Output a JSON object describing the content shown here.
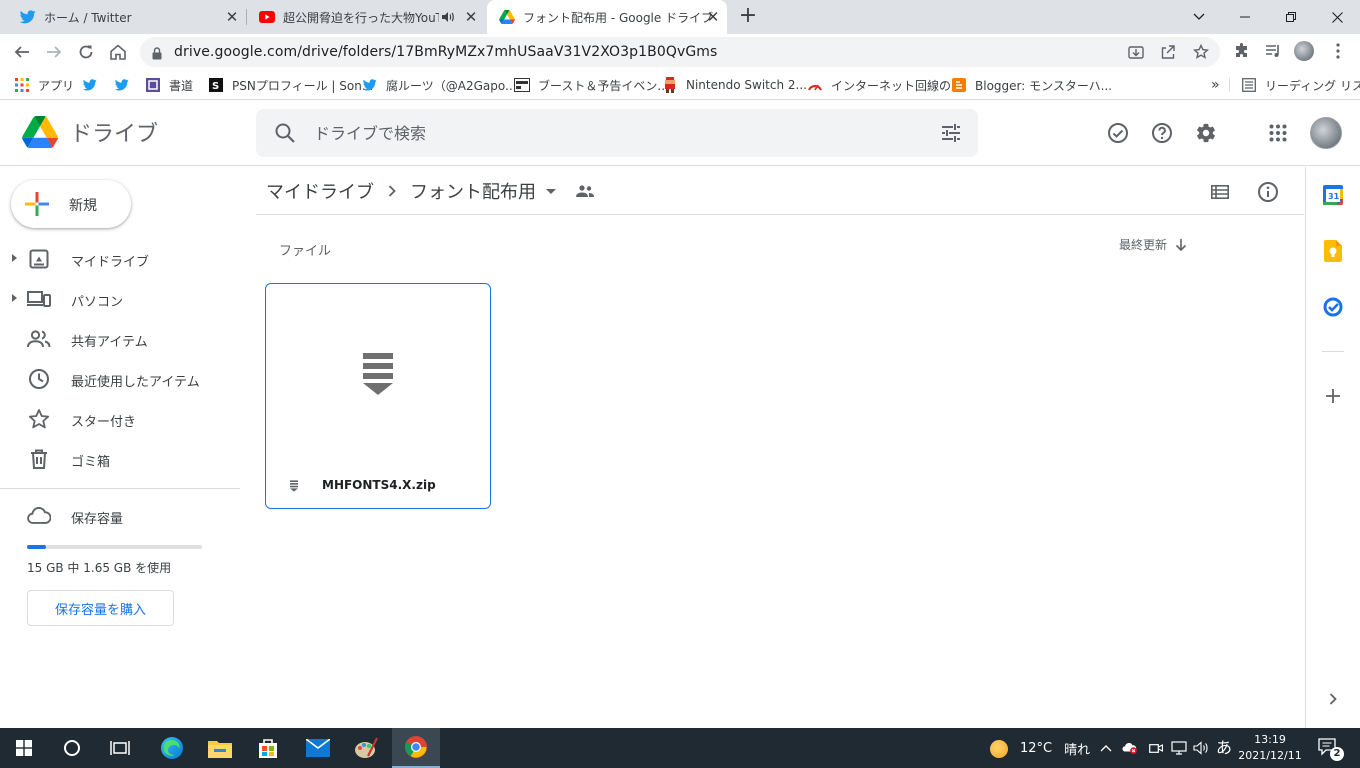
{
  "browser": {
    "tabs": [
      {
        "title": "ホーム / Twitter",
        "active": false
      },
      {
        "title": "超公開脅迫を行った大物YouTu",
        "active": false
      },
      {
        "title": "フォント配布用 - Google ドライブ",
        "active": true
      }
    ],
    "new_tab": "+",
    "url": "drive.google.com/drive/folders/17BmRyMZx7mhUSaaV31V2XO3p1B0QvGms",
    "bookmarks": [
      {
        "label": "アプリ",
        "icon": "apps-grid-icon"
      },
      {
        "label": "",
        "icon": "twitter-icon"
      },
      {
        "label": "",
        "icon": "twitter-icon"
      },
      {
        "label": "書道",
        "icon": "shodo-icon"
      },
      {
        "label": "PSNプロフィール | Son...",
        "icon": "psn-icon"
      },
      {
        "label": "腐ルーツ（@A2Gapo...",
        "icon": "twitter-icon"
      },
      {
        "label": "ブースト＆予告イベン...",
        "icon": "nes-icon"
      },
      {
        "label": "Nintendo Switch 2...",
        "icon": "mario-icon"
      },
      {
        "label": "インターネット回線の...",
        "icon": "speed-icon"
      },
      {
        "label": "Blogger: モンスターハ...",
        "icon": "blogger-icon"
      }
    ],
    "bookmarks_more": "»",
    "reading_list": "リーディング リスト"
  },
  "drive": {
    "app_name": "ドライブ",
    "search_placeholder": "ドライブで検索",
    "new_button": "新規",
    "nav": [
      {
        "label": "マイドライブ",
        "icon": "my-drive-icon",
        "expandable": true
      },
      {
        "label": "パソコン",
        "icon": "computers-icon",
        "expandable": true
      },
      {
        "label": "共有アイテム",
        "icon": "shared-icon",
        "expandable": false
      },
      {
        "label": "最近使用したアイテム",
        "icon": "recent-icon",
        "expandable": false
      },
      {
        "label": "スター付き",
        "icon": "star-icon",
        "expandable": false
      },
      {
        "label": "ゴミ箱",
        "icon": "trash-icon",
        "expandable": false
      }
    ],
    "storage": {
      "label": "保存容量",
      "usage_text": "15 GB 中 1.65 GB を使用",
      "used_fraction": 0.11,
      "buy_button": "保存容量を購入"
    },
    "breadcrumb": {
      "root": "マイドライブ",
      "current": "フォント配布用"
    },
    "section_label": "ファイル",
    "sort_label": "最終更新",
    "files": [
      {
        "name": "MHFONTS4.X.zip",
        "type": "zip"
      }
    ]
  },
  "taskbar": {
    "weather_temp": "12°C",
    "weather_condition": "晴れ",
    "ime": "あ",
    "time": "13:19",
    "date": "2021/12/11",
    "notification_count": "2"
  },
  "colors": {
    "accent": "#1a73e8",
    "taskbar": "#1f2a33",
    "tabbar": "#dee1e6"
  }
}
